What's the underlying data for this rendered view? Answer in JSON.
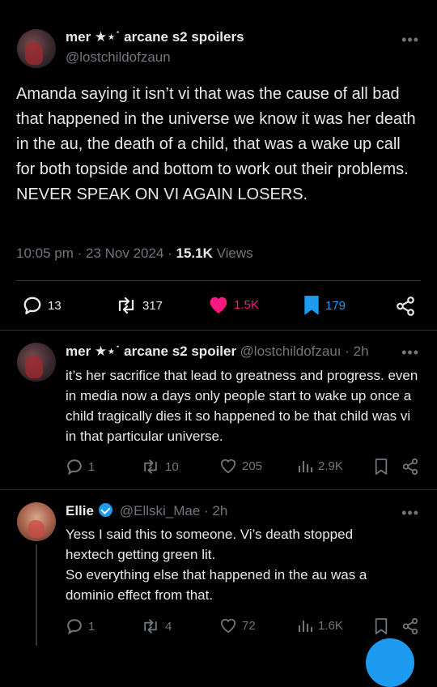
{
  "main_tweet": {
    "display_name": "mer ★⋆˙ arcane s2 spoilers",
    "handle": "@lostchildofzaun",
    "text": "Amanda saying it isn’t vi that was the cause of all bad that happened in the universe we know it was her death in the au, the death of a child, that was a wake up call for both topside and bottom to work out their problems. NEVER SPEAK ON VI AGAIN LOSERS.",
    "time": "10:05 pm · 23 Nov 2024 · ",
    "views_count": "15.1K",
    "views_label": " Views",
    "replies": "13",
    "retweets": "317",
    "likes": "1.5K",
    "bookmarks": "179",
    "more_icon": "more-horizontal-icon",
    "colors": {
      "like": "#f91880",
      "bookmark": "#1d9bf0"
    }
  },
  "reply1": {
    "display_name": "mer ★⋆˙ arcane s2 spoiler",
    "handle": "@lostchildofzauı",
    "time": " · 2h",
    "text": "it’s her sacrifice that lead to greatness and progress. even in media now a days only people start to wake up once a child tragically dies it so happened to be that child was vi in that particular universe.",
    "replies": "1",
    "retweets": "10",
    "likes": "205",
    "views": "2.9K"
  },
  "reply2": {
    "display_name": "Ellie",
    "handle": "@Ellski_Mae",
    "time": " · 2h",
    "text_lines": [
      "Yess I said this to someone. Vi’s death stopped",
      "hextech getting green lit.",
      "So everything else that happened in the au was a",
      "dominio effect from that."
    ],
    "replies": "1",
    "retweets": "4",
    "likes": "72",
    "views": "1.6K",
    "verified_color": "#1d9bf0"
  }
}
